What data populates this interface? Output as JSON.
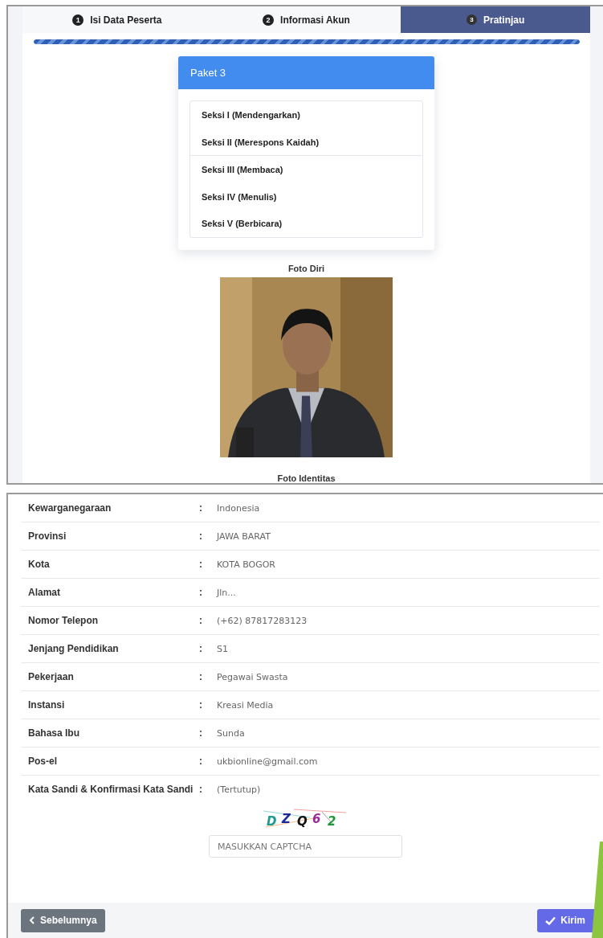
{
  "steps": [
    {
      "number": "1",
      "label": "Isi Data Peserta",
      "selected": false
    },
    {
      "number": "2",
      "label": "Informasi Akun",
      "selected": false
    },
    {
      "number": "3",
      "label": "Pratinjau",
      "selected": true
    }
  ],
  "progress": {
    "level": 1
  },
  "package": {
    "title": "Paket 3",
    "sections": [
      "Seksi I (Mendengarkan)",
      "Seksi II (Merespons Kaidah)",
      "Seksi III (Membaca)",
      "Seksi IV (Menulis)",
      "Seksi V (Berbicara)"
    ]
  },
  "photos": [
    {
      "label": "Foto Diri",
      "kind": "picture"
    },
    {
      "label": "Foto Identitas"
    }
  ],
  "details": [
    {
      "label": "Kewarganegaraan",
      "separator": ":",
      "value": "Indonesia"
    },
    {
      "label": "Provinsi",
      "separator": ":",
      "value": "JAWA BARAT"
    },
    {
      "label": "Kota",
      "separator": ":",
      "value": "KOTA BOGOR"
    },
    {
      "label": "Alamat",
      "separator": ":",
      "value": "Jln..."
    },
    {
      "label": "Nomor Telepon",
      "separator": ":",
      "value": "(+62) 87817283123"
    },
    {
      "label": "Jenjang Pendidikan",
      "separator": ":",
      "value": "S1"
    },
    {
      "label": "Pekerjaan",
      "separator": ":",
      "value": "Pegawai Swasta"
    },
    {
      "label": "Instansi",
      "separator": ":",
      "value": "Kreasi Media"
    },
    {
      "label": "Bahasa Ibu",
      "separator": ":",
      "value": "Sunda"
    },
    {
      "label": "Pos-el",
      "separator": ":",
      "value": "ukbionline@gmail.com"
    },
    {
      "label": "Kata Sandi & Konfirmasi Kata Sandi",
      "separator": ":",
      "value": "(Tertutup)"
    }
  ],
  "captcha": {
    "characters": [
      {
        "char": "D",
        "color": "#1f9a8c"
      },
      {
        "char": "Z",
        "color": "#1c2a9c"
      },
      {
        "char": "Q",
        "color": "#111111"
      },
      {
        "char": "6",
        "color": "#9a2a9a"
      },
      {
        "char": "2",
        "color": "#1f9a3a"
      }
    ],
    "placeholder": "MASUKKAN CAPTCHA"
  },
  "buttons": {
    "previous": "Sebelumnya",
    "submit": "Kirim"
  }
}
